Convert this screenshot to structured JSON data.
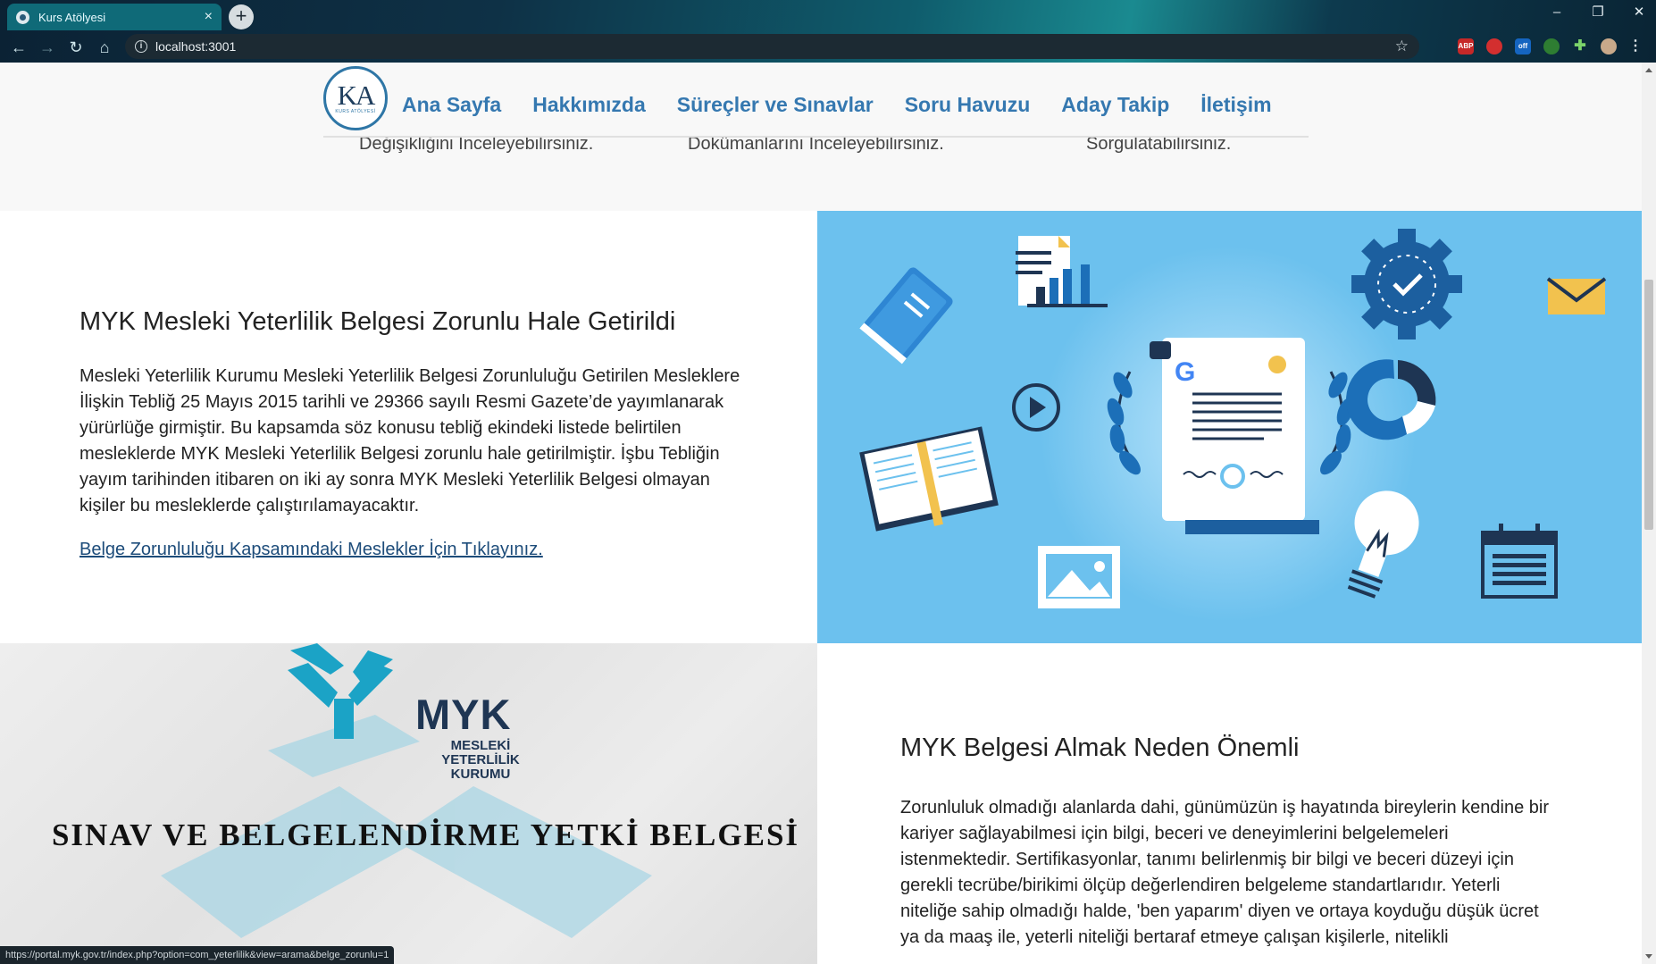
{
  "browser": {
    "tab_title": "Kurs Atölyesi",
    "tab_close": "×",
    "new_tab": "+",
    "url": "localhost:3001",
    "window_controls": [
      "–",
      "❐",
      "✕"
    ],
    "extensions": [
      "ABP",
      "",
      "off",
      "",
      "",
      ""
    ],
    "status_url": "https://portal.myk.gov.tr/index.php?option=com_yeterlilik&view=arama&belge_zorunlu=1"
  },
  "header": {
    "logo_text": "KA",
    "logo_sub": "KURS ATÖLYESİ",
    "nav": [
      "Ana Sayfa",
      "Hakkımızda",
      "Süreçler ve Sınavlar",
      "Soru Havuzu",
      "Aday Takip",
      "İletişim"
    ]
  },
  "features_partial": [
    "Değişikliğini İnceleyebilirsiniz.",
    "Dokümanlarını İnceleyebilirsiniz.",
    "Sorgulatabilirsiniz."
  ],
  "section1": {
    "title": "MYK Mesleki Yeterlilik Belgesi Zorunlu Hale Getirildi",
    "body": "Mesleki Yeterlilik Kurumu Mesleki Yeterlilik Belgesi Zorunluluğu Getirilen Mesleklere İlişkin Tebliğ 25 Mayıs 2015 tarihli ve 29366 sayılı Resmi Gazete’de yayımlanarak yürürlüğe girmiştir. Bu kapsamda söz konusu tebliğ ekindeki listede belirtilen mesleklerde MYK Mesleki Yeterlilik Belgesi zorunlu hale getirilmiştir. İşbu Tebliğin yayım tarihinden itibaren on iki ay sonra MYK Mesleki Yeterlilik Belgesi olmayan kişiler bu mesleklerde çalıştırılamayacaktır.",
    "link": "Belge Zorunluluğu Kapsamındaki Meslekler İçin Tıklayınız."
  },
  "section2_image": {
    "brand": "MYK",
    "brand_sub": "MESLEKİ YETERLİLİK KURUMU",
    "caption": "SINAV VE BELGELENDİRME YETKİ BELGESİ"
  },
  "section2": {
    "title": "MYK Belgesi Almak Neden Önemli",
    "body": "Zorunluluk olmadığı alanlarda dahi, günümüzün iş hayatında bireylerin kendine bir kariyer sağlayabilmesi için bilgi, beceri ve deneyimlerini belgelemeleri istenmektedir. Sertifikasyonlar, tanımı belirlenmiş bir bilgi ve beceri düzeyi için gerekli tecrübe/birikimi ölçüp değerlendiren belgeleme standartlarıdır. Yeterli niteliğe sahip olmadığı halde, 'ben yaparım' diyen ve ortaya koyduğu düşük ücret ya da maaş ile, yeterli niteliği bertaraf etmeye çalışan kişilerle, nitelikli"
  },
  "colors": {
    "nav_link": "#3578b0",
    "illustration_bg": "#6cc1ee",
    "icon_dark_blue": "#1c5f9f",
    "icon_navy": "#1e3553",
    "myk_teal": "#1ba3c6"
  }
}
